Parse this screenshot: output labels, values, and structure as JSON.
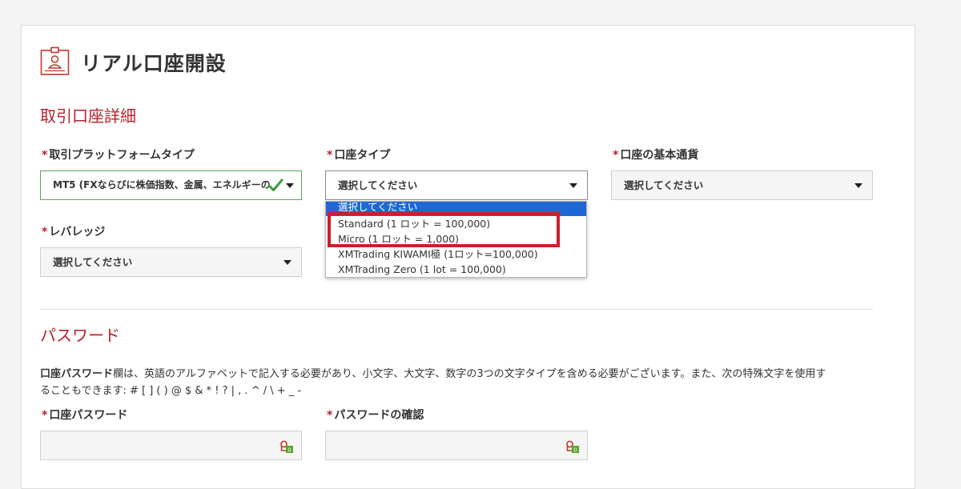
{
  "page": {
    "title": "リアル口座開設"
  },
  "account_details": {
    "section_title": "取引口座詳細",
    "required_mark": "*",
    "platform": {
      "label": "取引プラットフォームタイプ",
      "value": "MT5 (FXならびに株価指数、金属、エネルギーの"
    },
    "account_type": {
      "label": "口座タイプ",
      "value": "選択してください",
      "options": [
        "選択してください",
        "Standard (1 ロット = 100,000)",
        "Micro (1 ロット = 1,000)",
        "XMTrading KIWAMI極 (1ロット=100,000)",
        "XMTrading Zero (1 lot = 100,000)"
      ]
    },
    "base_currency": {
      "label": "口座の基本通貨",
      "value": "選択してください"
    },
    "leverage": {
      "label": "レバレッジ",
      "value": "選択してください"
    }
  },
  "password": {
    "section_title": "パスワード",
    "desc_bold": "口座パスワード",
    "desc_line1": "欄は、英語のアルファベットで記入する必要があり、小文字、大文字、数字の3つの文字タイプを含める必要がございます。また、次の特殊文字を使用す",
    "desc_line2": "ることもできます: # [ ] ( ) @ $ & * ! ? | , . ^ / \\ + _ -",
    "account_password_label": "口座パスワード",
    "confirm_label": "パスワードの確認"
  },
  "colors": {
    "accent": "#b8202a",
    "highlight": "#cc1e2e",
    "selected_option": "#1e68d6",
    "valid_border": "#5aa05a",
    "check": "#3c9a3c"
  },
  "icons": [
    "id-card-icon",
    "chevron-down-icon",
    "checkmark-icon",
    "password-key-icon"
  ]
}
